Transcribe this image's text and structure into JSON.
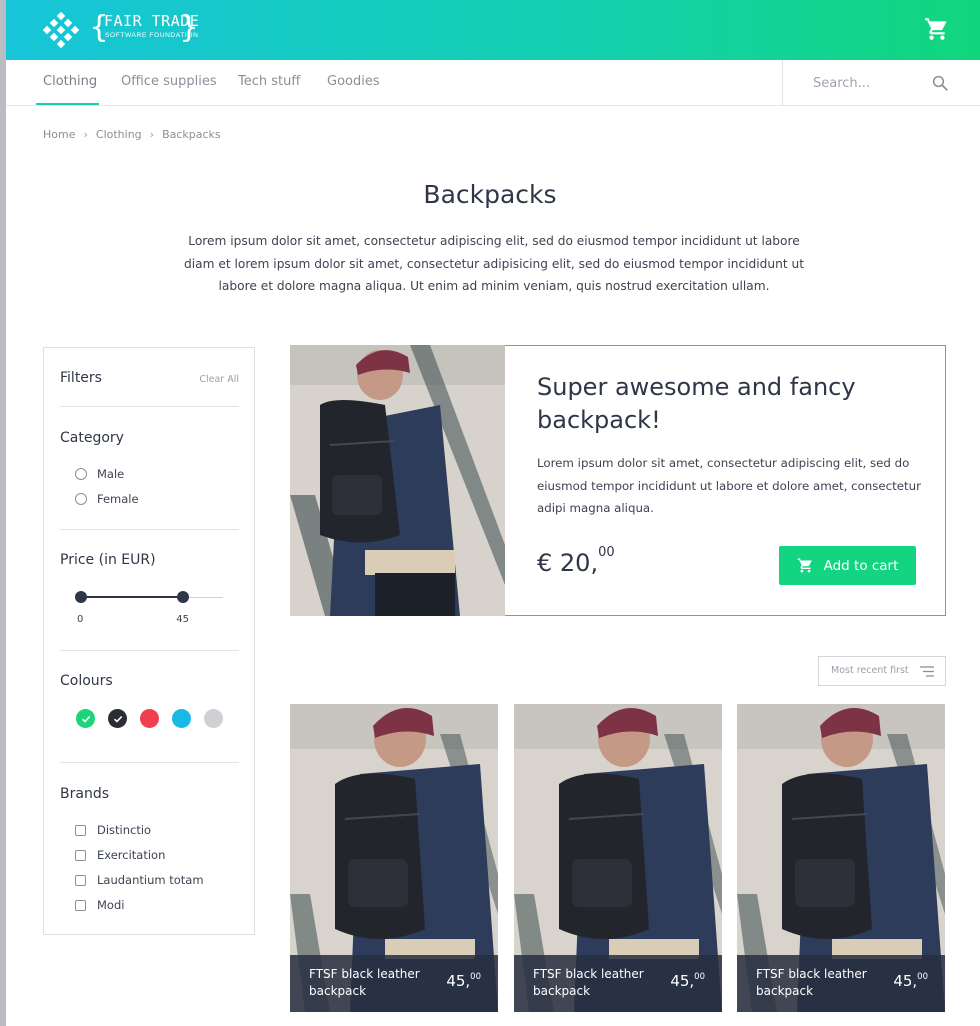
{
  "header": {
    "logo_text": "FAIR TRADE",
    "logo_subtext": "SOFTWARE FOUNDATION",
    "brace_open": "{",
    "brace_close": "}"
  },
  "nav": {
    "tabs": [
      {
        "label": "Clothing",
        "active": true
      },
      {
        "label": "Office supplies"
      },
      {
        "label": "Tech stuff"
      },
      {
        "label": "Goodies"
      }
    ],
    "search_placeholder": "Search..."
  },
  "breadcrumb": [
    "Home",
    "Clothing",
    "Backpacks"
  ],
  "breadcrumb_separator": "›",
  "page": {
    "title": "Backpacks",
    "intro": "Lorem ipsum dolor sit amet, consectetur adipiscing elit, sed do eiusmod tempor incididunt ut labore  diam et lorem ipsum dolor sit amet, consectetur adipisicing elit, sed do eiusmod tempor incididunt ut labore et dolore magna aliqua. Ut enim ad minim veniam, quis nostrud exercitation ullam."
  },
  "filters": {
    "title": "Filters",
    "clear_label": "Clear All",
    "category": {
      "title": "Category",
      "options": [
        "Male",
        "Female"
      ]
    },
    "price": {
      "title": "Price (in EUR)",
      "min_label": "0",
      "max_label": "45",
      "range_fill": 0.72
    },
    "colours": {
      "title": "Colours",
      "swatches": [
        {
          "name": "green",
          "color": "#1ed37a",
          "selected": true
        },
        {
          "name": "black",
          "color": "#2a2d35",
          "selected": true
        },
        {
          "name": "red",
          "color": "#f0404f",
          "selected": false
        },
        {
          "name": "cyan",
          "color": "#1ab8e6",
          "selected": false
        },
        {
          "name": "grey",
          "color": "#cfd0d3",
          "selected": false
        }
      ]
    },
    "brands": {
      "title": "Brands",
      "options": [
        "Distinctio",
        "Exercitation",
        "Laudantium totam",
        "Modi"
      ]
    }
  },
  "featured": {
    "title": "Super awesome and fancy backpack!",
    "description": "Lorem ipsum dolor sit amet, consectetur adipiscing elit, sed do eiusmod tempor incididunt ut labore et dolore  amet, consectetur adipi magna aliqua.",
    "price_main": "€ 20,",
    "price_cents": "00",
    "button_label": "Add to cart"
  },
  "sort": {
    "label": "Most recent first"
  },
  "products": [
    {
      "name": "FTSF black leather backpack",
      "price_main": "45,",
      "price_cents": "00"
    },
    {
      "name": "FTSF black leather backpack",
      "price_main": "45,",
      "price_cents": "00"
    },
    {
      "name": "FTSF black leather backpack",
      "price_main": "45,",
      "price_cents": "00"
    }
  ],
  "colors": {
    "accent": "#15cfb0",
    "button": "#13d480",
    "text_dark": "#2f3647"
  }
}
